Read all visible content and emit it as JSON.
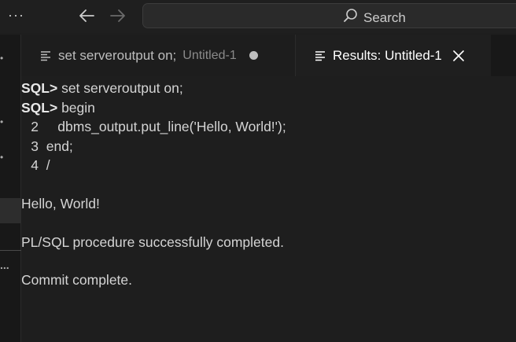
{
  "titlebar": {
    "more_icon": "ellipsis-icon",
    "back_icon": "arrow-left-icon",
    "forward_icon": "arrow-right-icon",
    "search_label": "Search",
    "search_icon": "search-icon"
  },
  "tabs": [
    {
      "label": "set serveroutput on;",
      "sub": "Untitled-1",
      "icon": "list-icon",
      "dirty": true,
      "active": false
    },
    {
      "label": "Results: Untitled-1",
      "icon": "list-icon",
      "active": true,
      "close_icon": "close-icon"
    }
  ],
  "side": {
    "marks": [
      "•",
      "•",
      "•",
      "..."
    ]
  },
  "output": {
    "prompt": "SQL>",
    "cmd1": " set serveroutput on;",
    "cmd2": " begin",
    "lines": [
      {
        "no": "2",
        "text": "     dbms_output.put_line('Hello, World!');"
      },
      {
        "no": "3",
        "text": "  end;"
      },
      {
        "no": "4",
        "text": "  /"
      }
    ],
    "result1": "Hello, World!",
    "result2": "PL/SQL procedure successfully completed.",
    "result3": "Commit complete."
  }
}
